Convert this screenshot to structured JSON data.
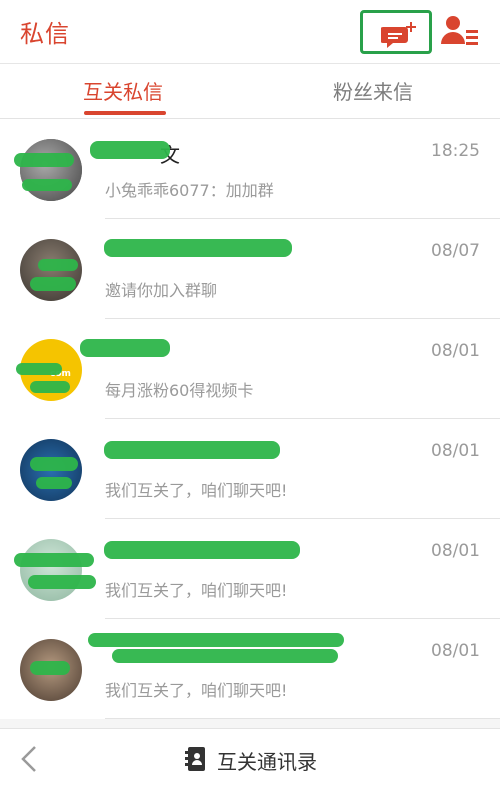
{
  "header": {
    "title": "私信",
    "compose_icon": "add-chat-icon",
    "contacts_icon": "contact-list-icon",
    "accent_color": "#d9452f",
    "highlight_color": "#29a14a"
  },
  "tabs": [
    {
      "label": "互关私信",
      "active": true
    },
    {
      "label": "粉丝来信",
      "active": false
    }
  ],
  "conversations": [
    {
      "name": "文",
      "message": "小兔乖乖6077：加加群",
      "time": "18:25"
    },
    {
      "name": "",
      "message": "邀请你加入群聊",
      "time": "08/07"
    },
    {
      "name": "",
      "message": "每月涨粉60得视频卡",
      "time": "08/01",
      "avatar_text": "com"
    },
    {
      "name": "",
      "message": "我们互关了，咱们聊天吧!",
      "time": "08/01"
    },
    {
      "name": "",
      "message": "我们互关了，咱们聊天吧!",
      "time": "08/01"
    },
    {
      "name": "",
      "message": "我们互关了，咱们聊天吧!",
      "time": "08/01"
    }
  ],
  "footer": {
    "back_icon": "chevron-left-icon",
    "contacts_label": "互关通讯录",
    "contacts_icon": "address-book-icon"
  }
}
